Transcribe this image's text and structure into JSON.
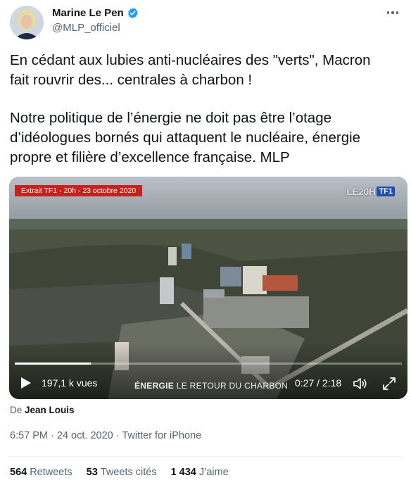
{
  "author": {
    "display_name": "Marine Le Pen",
    "handle": "@MLP_officiel",
    "verified": true
  },
  "tweet": {
    "paragraph1_line1": "En cédant aux lubies anti-nucléaires des \"verts\", Macron",
    "paragraph1_line2": "fait rouvrir des... centrales à charbon !",
    "paragraph2_line1": "Notre politique de l’énergie ne doit pas être l’otage",
    "paragraph2_line2": "d’idéologues bornés qui attaquent le nucléaire, énergie",
    "paragraph2_line3": "propre et filière d’excellence française. MLP"
  },
  "video": {
    "extract_label": "Extrait TF1 - 20h - 23 octobre 2020",
    "channel_20h": "LE20H",
    "channel_tf1": "TF1",
    "views": "197,1 k vues",
    "caption_strong": "ÉNERGIE",
    "caption_rest": "LE RETOUR DU CHARBON",
    "time": "0:27 / 2:18",
    "progress_fraction": 0.196
  },
  "byline": {
    "prefix": "De",
    "author": "Jean Louis"
  },
  "meta": {
    "timestamp": "6:57 PM · 24 oct. 2020 · Twitter for iPhone"
  },
  "stats": {
    "retweets_count": "564",
    "retweets_label": "Retweets",
    "quotes_count": "53",
    "quotes_label": "Tweets cités",
    "likes_count": "1 434",
    "likes_label": "J’aime"
  },
  "colors": {
    "verified": "#1d9bf0",
    "text_primary": "#0f1419",
    "text_secondary": "#536471",
    "extract_badge": "#c8211d"
  }
}
